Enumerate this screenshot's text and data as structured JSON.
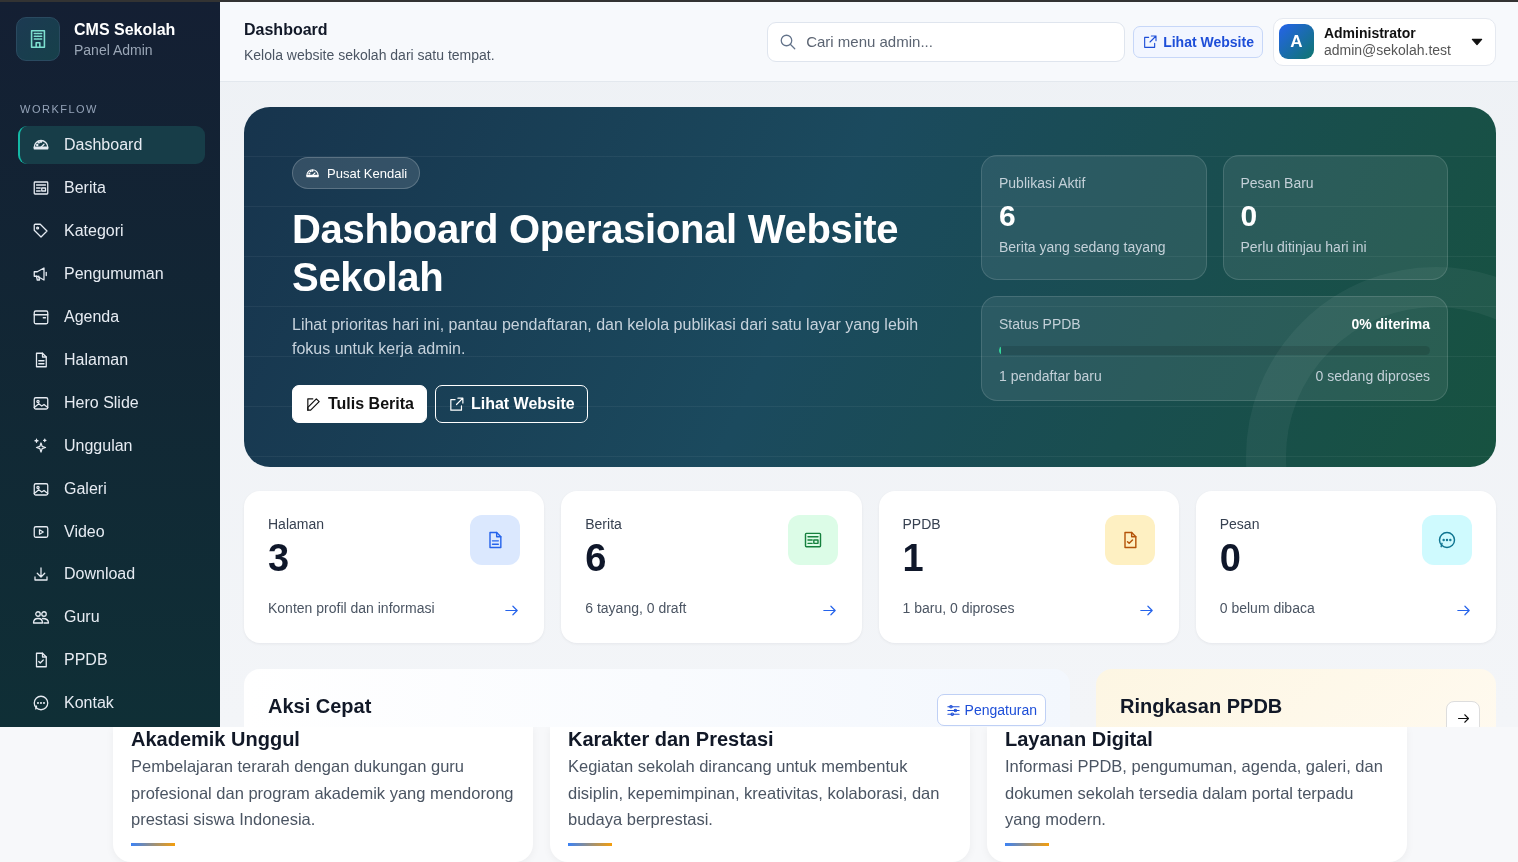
{
  "sidebar": {
    "brand": {
      "title": "CMS Sekolah",
      "subtitle": "Panel Admin"
    },
    "section": "WORKFLOW",
    "items": [
      {
        "label": "Dashboard",
        "selected": true
      },
      {
        "label": "Berita",
        "selected": false
      },
      {
        "label": "Kategori",
        "selected": false
      },
      {
        "label": "Pengumuman",
        "selected": false
      },
      {
        "label": "Agenda",
        "selected": false
      },
      {
        "label": "Halaman",
        "selected": false
      },
      {
        "label": "Hero Slide",
        "selected": false
      },
      {
        "label": "Unggulan",
        "selected": false
      },
      {
        "label": "Galeri",
        "selected": false
      },
      {
        "label": "Video",
        "selected": false
      },
      {
        "label": "Download",
        "selected": false
      },
      {
        "label": "Guru",
        "selected": false
      },
      {
        "label": "PPDB",
        "selected": false
      },
      {
        "label": "Kontak",
        "selected": false
      }
    ]
  },
  "topbar": {
    "title": "Dashboard",
    "subtitle": "Kelola website sekolah dari satu tempat.",
    "search": {
      "placeholder": "Cari menu admin..."
    },
    "website_link": "Lihat Website",
    "user": {
      "initial": "A",
      "name": "Administrator",
      "email": "admin@sekolah.test"
    }
  },
  "hero": {
    "badge": "Pusat Kendali",
    "title": "Dashboard Operasional Website Sekolah",
    "description": "Lihat prioritas hari ini, pantau pendaftaran, dan kelola publikasi dari satu layar yang lebih fokus untuk kerja admin.",
    "buttons": [
      {
        "label": "Tulis Berita",
        "kind": "primary"
      },
      {
        "label": "Lihat Website",
        "kind": "outline"
      }
    ],
    "metrics": [
      {
        "label": "Publikasi Aktif",
        "value": "6",
        "note": "Berita yang sedang tayang"
      },
      {
        "label": "Pesan Baru",
        "value": "0",
        "note": "Perlu ditinjau hari ini"
      }
    ],
    "ppdb_status": {
      "label": "Status PPDB",
      "reading": "0% diterima",
      "level": 0,
      "left_note": "1 pendaftar baru",
      "right_note": "0 sedang diproses"
    }
  },
  "stats": [
    {
      "label": "Halaman",
      "value": "3",
      "note": "Konten profil dan informasi",
      "color": "#dbe8fe"
    },
    {
      "label": "Berita",
      "value": "6",
      "note": "6 tayang, 0 draft",
      "color": "#dcfce7"
    },
    {
      "label": "PPDB",
      "value": "1",
      "note": "1 baru, 0 diproses",
      "color": "#fef0c2"
    },
    {
      "label": "Pesan",
      "value": "0",
      "note": "0 belum dibaca",
      "color": "#cffafe"
    }
  ],
  "panels": [
    {
      "kind": "quick",
      "title": "Aksi Cepat",
      "action": "Pengaturan"
    },
    {
      "kind": "summary",
      "title": "Ringkasan PPDB"
    }
  ],
  "features": [
    {
      "title": "Akademik Unggul",
      "text": "Pembelajaran terarah dengan dukungan guru profesional dan program akademik yang mendorong prestasi siswa Indonesia."
    },
    {
      "title": "Karakter dan Prestasi",
      "text": "Kegiatan sekolah dirancang untuk membentuk disiplin, kepemimpinan, kreativitas, kolaborasi, dan budaya berprestasi."
    },
    {
      "title": "Layanan Digital",
      "text": "Informasi PPDB, pengumuman, agenda, galeri, dan dokumen sekolah tersedia dalam portal terpadu yang modern."
    }
  ]
}
